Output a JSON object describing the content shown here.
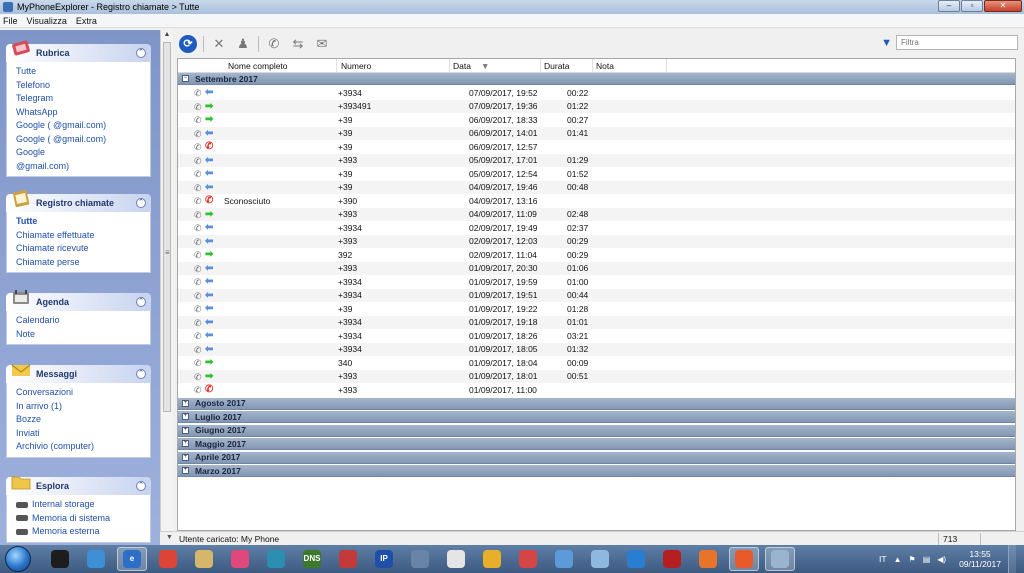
{
  "window": {
    "title": "MyPhoneExplorer -  Registro chiamate > Tutte",
    "controls": {
      "minimize": "–",
      "maximize": "▫",
      "close": "✕"
    }
  },
  "menu": [
    "File",
    "Visualizza",
    "Extra"
  ],
  "sidebar": {
    "rubrica": {
      "title": "Rubrica",
      "items": [
        "Tutte",
        "Telefono",
        "Telegram",
        "WhatsApp",
        "Google (                @gmail.com)",
        "Google (                @gmail.com)",
        "Google",
        "                     @gmail.com)"
      ]
    },
    "registro": {
      "title": "Registro chiamate",
      "items": [
        "Tutte",
        "Chiamate effettuate",
        "Chiamate ricevute",
        "Chiamate perse"
      ]
    },
    "agenda": {
      "title": "Agenda",
      "items": [
        "Calendario",
        "Note"
      ]
    },
    "messaggi": {
      "title": "Messaggi",
      "items": [
        "Conversazioni",
        "In arrivo (1)",
        "Bozze",
        "Inviati",
        "Archivio (computer)"
      ]
    },
    "esplora": {
      "title": "Esplora",
      "items": [
        "Internal storage",
        "Memoria di sistema",
        "Memoria esterna"
      ]
    }
  },
  "toolbar": {
    "filter_placeholder": "Filtra"
  },
  "grid": {
    "columns": [
      "Nome completo",
      "Numero",
      "Data",
      "Durata",
      "Nota"
    ],
    "expanded_group": "Settembre 2017",
    "rows": [
      {
        "dir": "in",
        "name": "",
        "number": "+3934",
        "date": "07/09/2017, 19:52",
        "duration": "00:22"
      },
      {
        "dir": "out",
        "name": "",
        "number": "+393491",
        "date": "07/09/2017, 19:36",
        "duration": "01:22"
      },
      {
        "dir": "out",
        "name": "",
        "number": "+39",
        "date": "06/09/2017, 18:33",
        "duration": "00:27"
      },
      {
        "dir": "in",
        "name": "",
        "number": "+39",
        "date": "06/09/2017, 14:01",
        "duration": "01:41"
      },
      {
        "dir": "miss",
        "name": "",
        "number": "+39",
        "date": "06/09/2017, 12:57",
        "duration": ""
      },
      {
        "dir": "in",
        "name": "",
        "number": "+393",
        "date": "05/09/2017, 17:01",
        "duration": "01:29"
      },
      {
        "dir": "in",
        "name": "",
        "number": "+39",
        "date": "05/09/2017, 12:54",
        "duration": "01:52"
      },
      {
        "dir": "in",
        "name": "",
        "number": "+39",
        "date": "04/09/2017, 19:46",
        "duration": "00:48"
      },
      {
        "dir": "miss",
        "name": "Sconosciuto",
        "number": "+390",
        "date": "04/09/2017, 13:16",
        "duration": ""
      },
      {
        "dir": "out",
        "name": "",
        "number": "+393",
        "date": "04/09/2017, 11:09",
        "duration": "02:48"
      },
      {
        "dir": "in",
        "name": "",
        "number": "+3934",
        "date": "02/09/2017, 19:49",
        "duration": "02:37"
      },
      {
        "dir": "in",
        "name": "",
        "number": "+393",
        "date": "02/09/2017, 12:03",
        "duration": "00:29"
      },
      {
        "dir": "out",
        "name": "",
        "number": "392",
        "date": "02/09/2017, 11:04",
        "duration": "00:29"
      },
      {
        "dir": "in",
        "name": "",
        "number": "+393",
        "date": "01/09/2017, 20:30",
        "duration": "01:06"
      },
      {
        "dir": "in",
        "name": "",
        "number": "+3934",
        "date": "01/09/2017, 19:59",
        "duration": "01:00"
      },
      {
        "dir": "in",
        "name": "",
        "number": "+3934",
        "date": "01/09/2017, 19:51",
        "duration": "00:44"
      },
      {
        "dir": "in",
        "name": "",
        "number": "+39",
        "date": "01/09/2017, 19:22",
        "duration": "01:28"
      },
      {
        "dir": "in",
        "name": "",
        "number": "+3934",
        "date": "01/09/2017, 19:18",
        "duration": "01:01"
      },
      {
        "dir": "in",
        "name": "",
        "number": "+3934",
        "date": "01/09/2017, 18:26",
        "duration": "03:21"
      },
      {
        "dir": "in",
        "name": "",
        "number": "+3934",
        "date": "01/09/2017, 18:05",
        "duration": "01:32"
      },
      {
        "dir": "out",
        "name": "",
        "number": "340",
        "date": "01/09/2017, 18:04",
        "duration": "00:09"
      },
      {
        "dir": "out",
        "name": "",
        "number": "+393",
        "date": "01/09/2017, 18:01",
        "duration": "00:51"
      },
      {
        "dir": "miss",
        "name": "",
        "number": "+393",
        "date": "01/09/2017, 11:00",
        "duration": ""
      }
    ],
    "collapsed_groups": [
      "Agosto 2017",
      "Luglio 2017",
      "Giugno 2017",
      "Maggio 2017",
      "Aprile 2017",
      "Marzo 2017"
    ]
  },
  "statusbar": {
    "text": "Utente caricato: My Phone",
    "count": "713"
  },
  "taskbar": {
    "apps": [
      {
        "label": "",
        "color": "#1d1d1d"
      },
      {
        "label": "",
        "color": "#3d8fd6"
      },
      {
        "label": "e",
        "color": "#2d6fc7",
        "active": true
      },
      {
        "label": "",
        "color": "#db4437"
      },
      {
        "label": "",
        "color": "#d6b66a"
      },
      {
        "label": "",
        "color": "#e0477a"
      },
      {
        "label": "",
        "color": "#2a8fb0"
      },
      {
        "label": "DNS",
        "color": "#3a7a2a"
      },
      {
        "label": "",
        "color": "#c23a3a"
      },
      {
        "label": "IP",
        "color": "#1f4fa8"
      },
      {
        "label": "",
        "color": "#6a84a8"
      },
      {
        "label": "",
        "color": "#e5e5e5"
      },
      {
        "label": "",
        "color": "#e8b02a"
      },
      {
        "label": "",
        "color": "#d64545"
      },
      {
        "label": "",
        "color": "#5a9bd8"
      },
      {
        "label": "",
        "color": "#8fb8de"
      },
      {
        "label": "",
        "color": "#2a7ed1"
      },
      {
        "label": "",
        "color": "#b51f1f"
      },
      {
        "label": "",
        "color": "#e8742a"
      },
      {
        "label": "",
        "color": "#e85a2a",
        "active": true
      },
      {
        "label": "",
        "color": "#9ab3cf",
        "active": true
      }
    ],
    "tray": {
      "language": "IT",
      "time": "13:55",
      "date": "09/11/2017"
    }
  }
}
